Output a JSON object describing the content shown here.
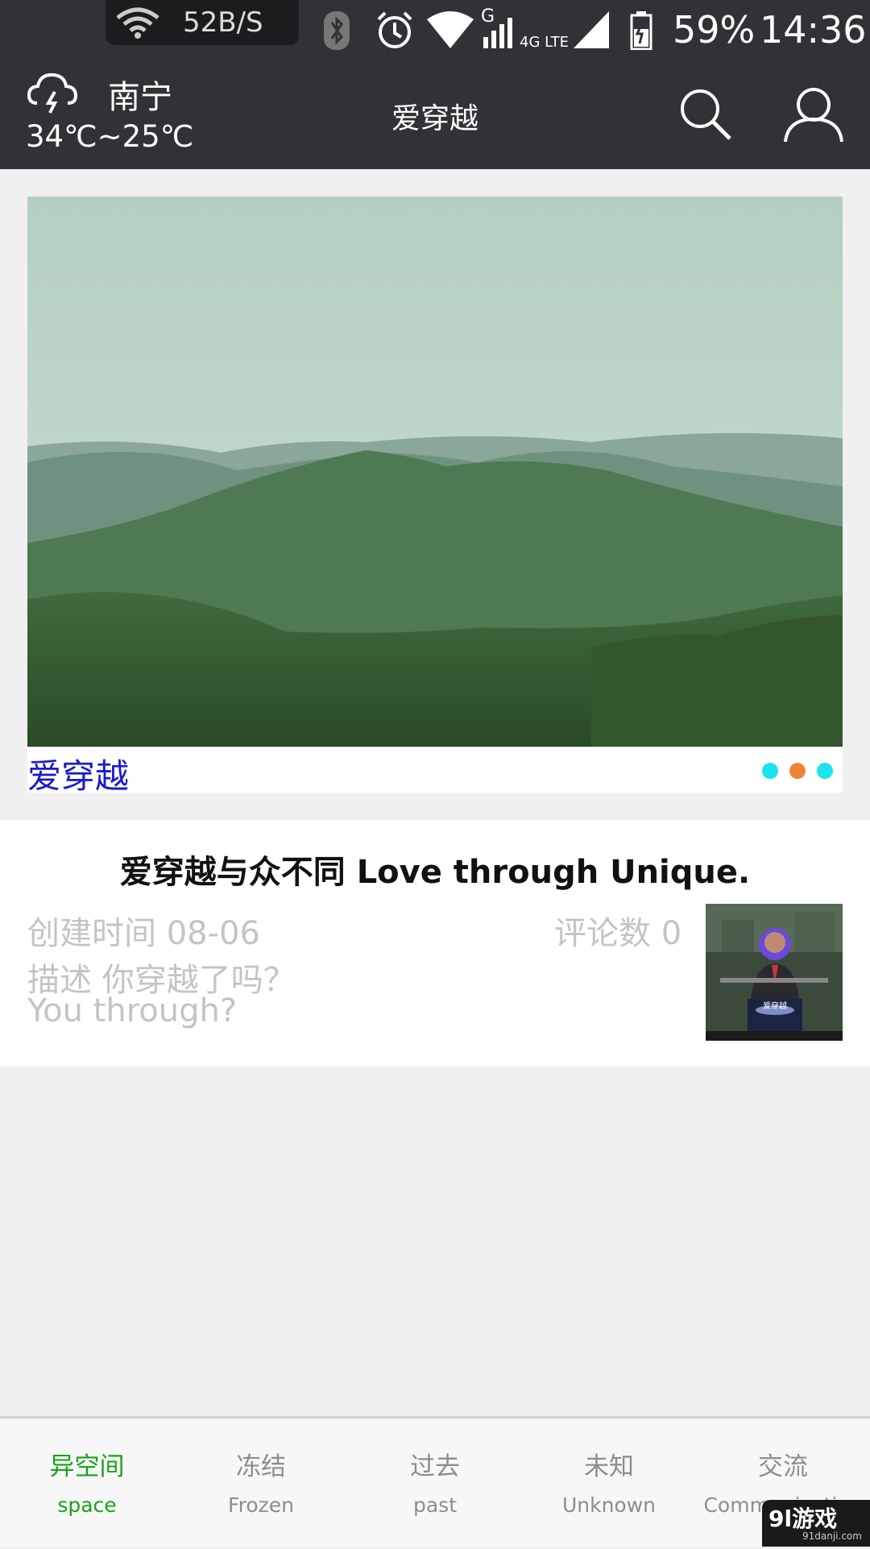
{
  "status_bar": {
    "network_speed": "52B/S",
    "signal_type_label": "G",
    "lte_label": "4G LTE",
    "battery_percent": "59%",
    "time": "14:36",
    "icons": [
      "wifi-icon",
      "bluetooth-icon",
      "alarm-icon",
      "wifi-signal-icon",
      "cell-signal-icon",
      "battery-icon"
    ]
  },
  "app_bar": {
    "city": "南宁",
    "temperature": "34℃~25℃",
    "title": "爱穿越",
    "weather_icon": "thunderstorm-cloud-icon",
    "search_icon": "search-icon",
    "user_icon": "user-icon",
    "background": "#323136"
  },
  "banner": {
    "caption": "爱穿越",
    "caption_color": "#1a1acc",
    "image": "misty-green-mountains",
    "dots": [
      {
        "color": "#1de3ef"
      },
      {
        "color": "#ef8339"
      },
      {
        "color": "#1de3ef"
      }
    ],
    "active_dot_index": 1
  },
  "article": {
    "title": "爱穿越与众不同 Love through Unique.",
    "created_label": "创建时间 08-06",
    "comments_label": "评论数 0",
    "description_line1": "描述 你穿越了吗？",
    "description_line2": "You through?",
    "thumbnail": "speaker-at-podium",
    "thumbnail_caption": "爱穿越"
  },
  "bottom_nav": {
    "items": [
      {
        "cn": "异空间",
        "en": "space",
        "active": true
      },
      {
        "cn": "冻结",
        "en": "Frozen",
        "active": false
      },
      {
        "cn": "过去",
        "en": "past",
        "active": false
      },
      {
        "cn": "未知",
        "en": "Unknown",
        "active": false
      },
      {
        "cn": "交流",
        "en": "Communication",
        "active": false
      }
    ],
    "active_color": "#1aa31a",
    "inactive_color": "#8d8d8d"
  },
  "watermark": {
    "main": "9l游戏",
    "sub": "91danji.com"
  }
}
